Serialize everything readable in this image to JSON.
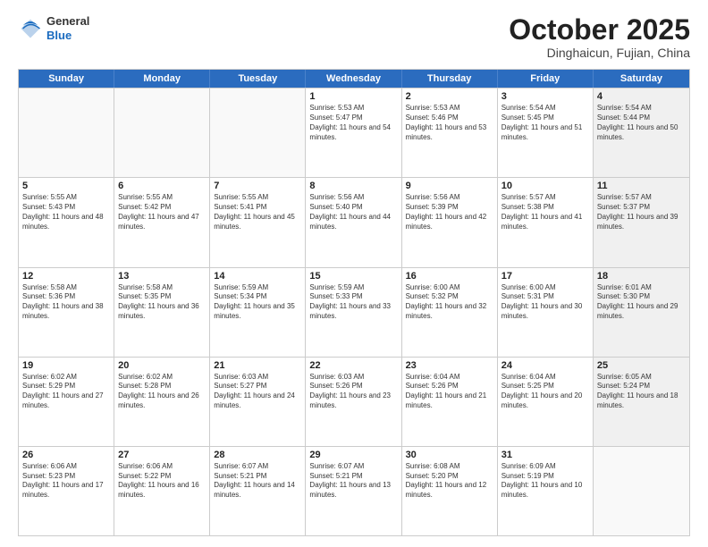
{
  "header": {
    "logo": {
      "general": "General",
      "blue": "Blue"
    },
    "title": "October 2025",
    "subtitle": "Dinghaicun, Fujian, China"
  },
  "days": [
    "Sunday",
    "Monday",
    "Tuesday",
    "Wednesday",
    "Thursday",
    "Friday",
    "Saturday"
  ],
  "rows": [
    [
      {
        "day": "",
        "sunrise": "",
        "sunset": "",
        "daylight": "",
        "empty": true
      },
      {
        "day": "",
        "sunrise": "",
        "sunset": "",
        "daylight": "",
        "empty": true
      },
      {
        "day": "",
        "sunrise": "",
        "sunset": "",
        "daylight": "",
        "empty": true
      },
      {
        "day": "1",
        "sunrise": "Sunrise: 5:53 AM",
        "sunset": "Sunset: 5:47 PM",
        "daylight": "Daylight: 11 hours and 54 minutes.",
        "empty": false
      },
      {
        "day": "2",
        "sunrise": "Sunrise: 5:53 AM",
        "sunset": "Sunset: 5:46 PM",
        "daylight": "Daylight: 11 hours and 53 minutes.",
        "empty": false
      },
      {
        "day": "3",
        "sunrise": "Sunrise: 5:54 AM",
        "sunset": "Sunset: 5:45 PM",
        "daylight": "Daylight: 11 hours and 51 minutes.",
        "empty": false
      },
      {
        "day": "4",
        "sunrise": "Sunrise: 5:54 AM",
        "sunset": "Sunset: 5:44 PM",
        "daylight": "Daylight: 11 hours and 50 minutes.",
        "empty": false,
        "shaded": true
      }
    ],
    [
      {
        "day": "5",
        "sunrise": "Sunrise: 5:55 AM",
        "sunset": "Sunset: 5:43 PM",
        "daylight": "Daylight: 11 hours and 48 minutes.",
        "empty": false
      },
      {
        "day": "6",
        "sunrise": "Sunrise: 5:55 AM",
        "sunset": "Sunset: 5:42 PM",
        "daylight": "Daylight: 11 hours and 47 minutes.",
        "empty": false
      },
      {
        "day": "7",
        "sunrise": "Sunrise: 5:55 AM",
        "sunset": "Sunset: 5:41 PM",
        "daylight": "Daylight: 11 hours and 45 minutes.",
        "empty": false
      },
      {
        "day": "8",
        "sunrise": "Sunrise: 5:56 AM",
        "sunset": "Sunset: 5:40 PM",
        "daylight": "Daylight: 11 hours and 44 minutes.",
        "empty": false
      },
      {
        "day": "9",
        "sunrise": "Sunrise: 5:56 AM",
        "sunset": "Sunset: 5:39 PM",
        "daylight": "Daylight: 11 hours and 42 minutes.",
        "empty": false
      },
      {
        "day": "10",
        "sunrise": "Sunrise: 5:57 AM",
        "sunset": "Sunset: 5:38 PM",
        "daylight": "Daylight: 11 hours and 41 minutes.",
        "empty": false
      },
      {
        "day": "11",
        "sunrise": "Sunrise: 5:57 AM",
        "sunset": "Sunset: 5:37 PM",
        "daylight": "Daylight: 11 hours and 39 minutes.",
        "empty": false,
        "shaded": true
      }
    ],
    [
      {
        "day": "12",
        "sunrise": "Sunrise: 5:58 AM",
        "sunset": "Sunset: 5:36 PM",
        "daylight": "Daylight: 11 hours and 38 minutes.",
        "empty": false
      },
      {
        "day": "13",
        "sunrise": "Sunrise: 5:58 AM",
        "sunset": "Sunset: 5:35 PM",
        "daylight": "Daylight: 11 hours and 36 minutes.",
        "empty": false
      },
      {
        "day": "14",
        "sunrise": "Sunrise: 5:59 AM",
        "sunset": "Sunset: 5:34 PM",
        "daylight": "Daylight: 11 hours and 35 minutes.",
        "empty": false
      },
      {
        "day": "15",
        "sunrise": "Sunrise: 5:59 AM",
        "sunset": "Sunset: 5:33 PM",
        "daylight": "Daylight: 11 hours and 33 minutes.",
        "empty": false
      },
      {
        "day": "16",
        "sunrise": "Sunrise: 6:00 AM",
        "sunset": "Sunset: 5:32 PM",
        "daylight": "Daylight: 11 hours and 32 minutes.",
        "empty": false
      },
      {
        "day": "17",
        "sunrise": "Sunrise: 6:00 AM",
        "sunset": "Sunset: 5:31 PM",
        "daylight": "Daylight: 11 hours and 30 minutes.",
        "empty": false
      },
      {
        "day": "18",
        "sunrise": "Sunrise: 6:01 AM",
        "sunset": "Sunset: 5:30 PM",
        "daylight": "Daylight: 11 hours and 29 minutes.",
        "empty": false,
        "shaded": true
      }
    ],
    [
      {
        "day": "19",
        "sunrise": "Sunrise: 6:02 AM",
        "sunset": "Sunset: 5:29 PM",
        "daylight": "Daylight: 11 hours and 27 minutes.",
        "empty": false
      },
      {
        "day": "20",
        "sunrise": "Sunrise: 6:02 AM",
        "sunset": "Sunset: 5:28 PM",
        "daylight": "Daylight: 11 hours and 26 minutes.",
        "empty": false
      },
      {
        "day": "21",
        "sunrise": "Sunrise: 6:03 AM",
        "sunset": "Sunset: 5:27 PM",
        "daylight": "Daylight: 11 hours and 24 minutes.",
        "empty": false
      },
      {
        "day": "22",
        "sunrise": "Sunrise: 6:03 AM",
        "sunset": "Sunset: 5:26 PM",
        "daylight": "Daylight: 11 hours and 23 minutes.",
        "empty": false
      },
      {
        "day": "23",
        "sunrise": "Sunrise: 6:04 AM",
        "sunset": "Sunset: 5:26 PM",
        "daylight": "Daylight: 11 hours and 21 minutes.",
        "empty": false
      },
      {
        "day": "24",
        "sunrise": "Sunrise: 6:04 AM",
        "sunset": "Sunset: 5:25 PM",
        "daylight": "Daylight: 11 hours and 20 minutes.",
        "empty": false
      },
      {
        "day": "25",
        "sunrise": "Sunrise: 6:05 AM",
        "sunset": "Sunset: 5:24 PM",
        "daylight": "Daylight: 11 hours and 18 minutes.",
        "empty": false,
        "shaded": true
      }
    ],
    [
      {
        "day": "26",
        "sunrise": "Sunrise: 6:06 AM",
        "sunset": "Sunset: 5:23 PM",
        "daylight": "Daylight: 11 hours and 17 minutes.",
        "empty": false
      },
      {
        "day": "27",
        "sunrise": "Sunrise: 6:06 AM",
        "sunset": "Sunset: 5:22 PM",
        "daylight": "Daylight: 11 hours and 16 minutes.",
        "empty": false
      },
      {
        "day": "28",
        "sunrise": "Sunrise: 6:07 AM",
        "sunset": "Sunset: 5:21 PM",
        "daylight": "Daylight: 11 hours and 14 minutes.",
        "empty": false
      },
      {
        "day": "29",
        "sunrise": "Sunrise: 6:07 AM",
        "sunset": "Sunset: 5:21 PM",
        "daylight": "Daylight: 11 hours and 13 minutes.",
        "empty": false
      },
      {
        "day": "30",
        "sunrise": "Sunrise: 6:08 AM",
        "sunset": "Sunset: 5:20 PM",
        "daylight": "Daylight: 11 hours and 12 minutes.",
        "empty": false
      },
      {
        "day": "31",
        "sunrise": "Sunrise: 6:09 AM",
        "sunset": "Sunset: 5:19 PM",
        "daylight": "Daylight: 11 hours and 10 minutes.",
        "empty": false
      },
      {
        "day": "",
        "sunrise": "",
        "sunset": "",
        "daylight": "",
        "empty": true,
        "shaded": true
      }
    ]
  ]
}
